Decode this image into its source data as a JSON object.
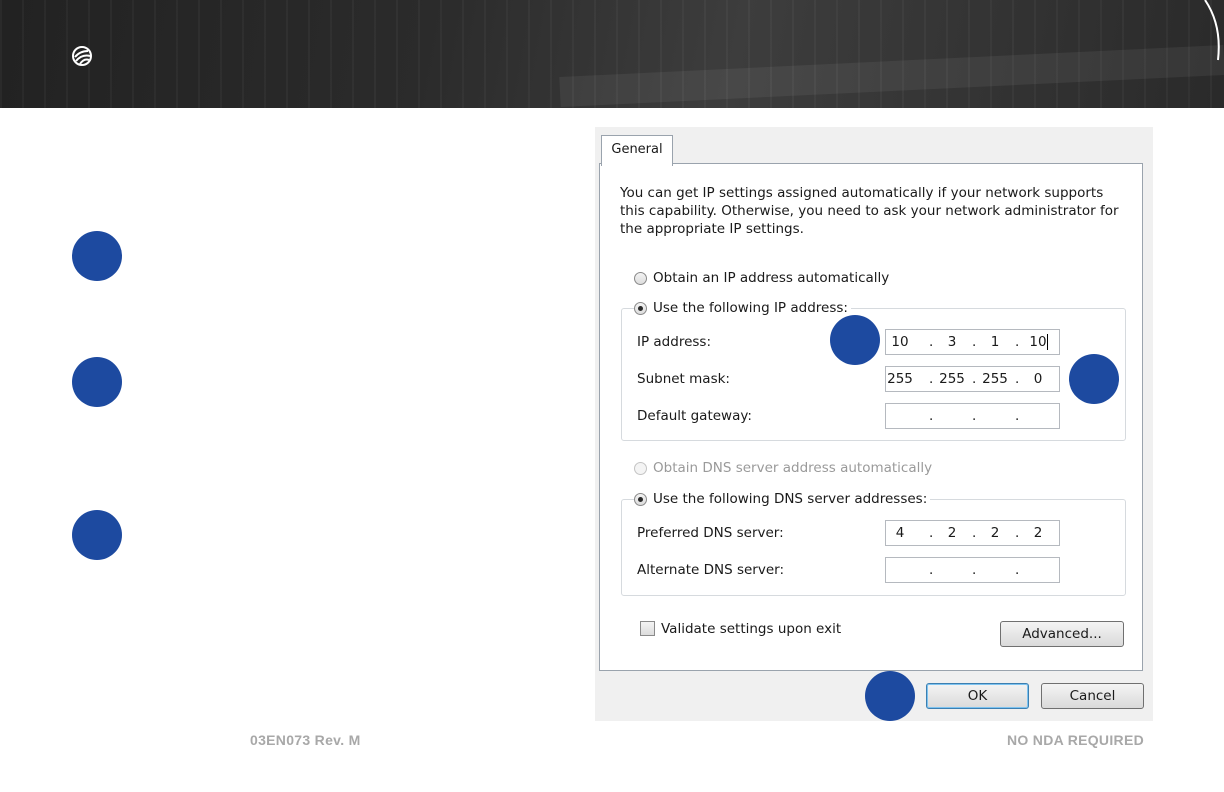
{
  "footer": {
    "doc_id": "03EN073 Rev. M",
    "nda": "NO NDA REQUIRED"
  },
  "dialog": {
    "tab": "General",
    "description": "You can get IP settings assigned automatically if your network supports this capability. Otherwise, you need to ask your network administrator for the appropriate IP settings.",
    "ip_mode": {
      "auto_label": "Obtain an IP address automatically",
      "manual_label": "Use the following IP address:",
      "selected": "manual"
    },
    "ip_fields": [
      {
        "label": "IP address:",
        "octets": [
          "10",
          "3",
          "1",
          "10"
        ]
      },
      {
        "label": "Subnet mask:",
        "octets": [
          "255",
          "255",
          "255",
          "0"
        ]
      },
      {
        "label": "Default gateway:",
        "octets": [
          "",
          "",
          "",
          ""
        ]
      }
    ],
    "dns_mode": {
      "auto_label": "Obtain DNS server address automatically",
      "manual_label": "Use the following DNS server addresses:",
      "selected": "manual"
    },
    "dns_fields": [
      {
        "label": "Preferred DNS server:",
        "octets": [
          "4",
          "2",
          "2",
          "2"
        ]
      },
      {
        "label": "Alternate DNS server:",
        "octets": [
          "",
          "",
          "",
          ""
        ]
      }
    ],
    "validate_label": "Validate settings upon exit",
    "validate_checked": false,
    "advanced_label": "Advanced...",
    "ok_label": "OK",
    "cancel_label": "Cancel"
  },
  "colors": {
    "marker": "#1d4aa0",
    "header": "#2b2b2b"
  },
  "icons": {
    "logo": "brand-logo-icon"
  }
}
